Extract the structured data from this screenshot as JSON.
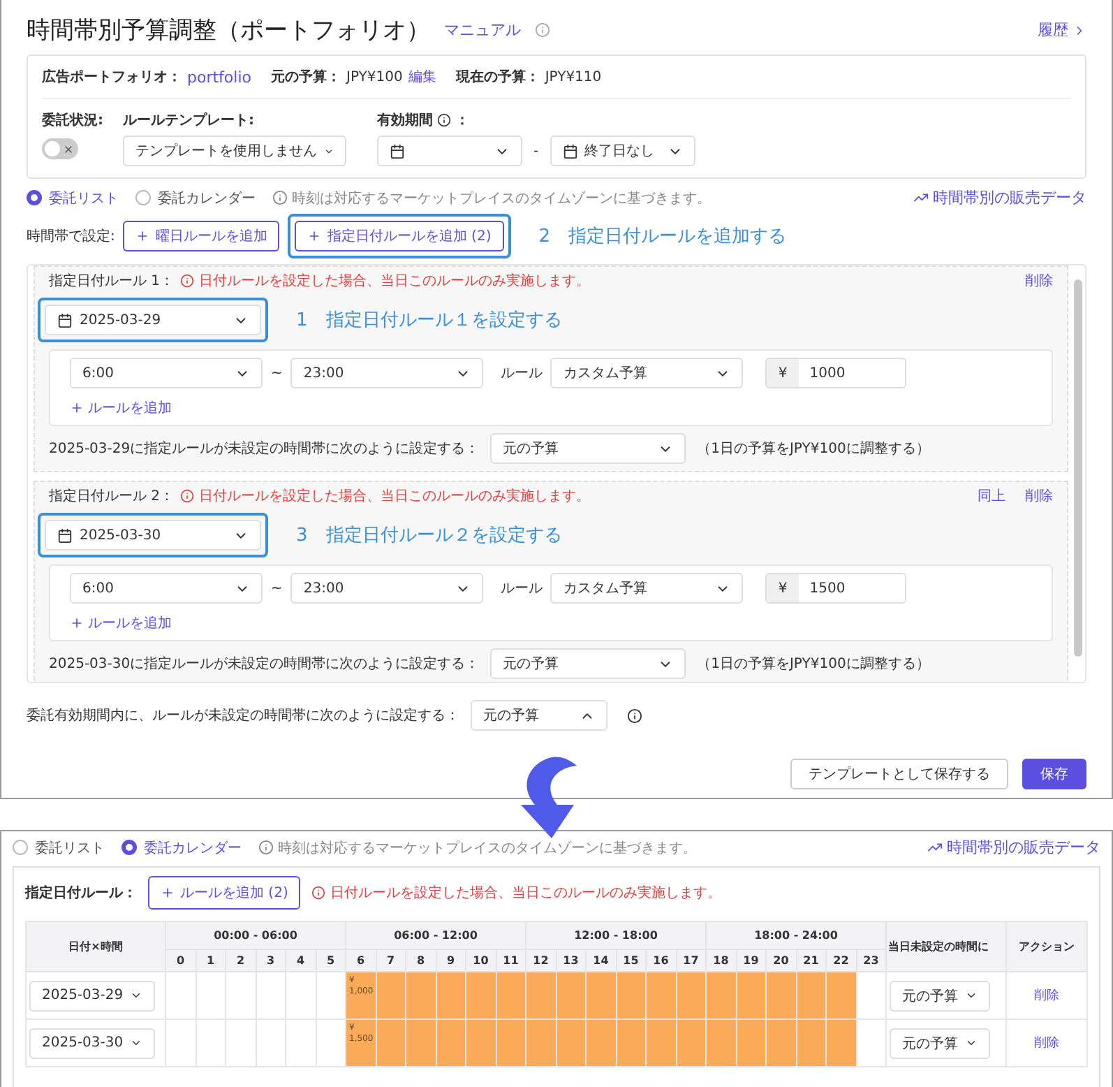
{
  "dialog": {
    "title": "時間帯別予算調整（ポートフォリオ）",
    "manual_link": "マニュアル",
    "history_link": "履歴",
    "info": {
      "items": [
        {
          "label": "広告ポートフォリオ：",
          "value": "portfolio",
          "kind": "link"
        },
        {
          "label": "元の予算：",
          "value": "JPY¥100",
          "edit": "編集",
          "kind": "text"
        },
        {
          "label": "現在の予算：",
          "value": "JPY¥110",
          "kind": "text"
        }
      ],
      "delegation": {
        "label": "委託状況:",
        "on": false
      },
      "template": {
        "label": "ルールテンプレート:",
        "value": "テンプレートを使用しません"
      },
      "period": {
        "label": "有効期間",
        "suffix": "：",
        "separator": "-",
        "end": "終了日なし"
      }
    },
    "views": [
      {
        "label": "委託リスト",
        "selected": true
      },
      {
        "label": "委託カレンダー",
        "selected": false
      }
    ],
    "timezone_note": "時刻は対応するマーケットプレイスのタイムゾーンに基づきます。",
    "sales_link": "時間帯別の販売データ",
    "slot_label": "時間帯で設定:",
    "add_buttons": [
      {
        "label": "曜日ルールを追加",
        "highlighted": false
      },
      {
        "label": "指定日付ルールを追加 (2)",
        "highlighted": true,
        "callout": "2　指定日付ルールを追加する"
      }
    ],
    "date_rules": [
      {
        "label": "指定日付ルール 1：",
        "warning": "日付ルールを設定した場合、当日このルールのみ実施します。",
        "actions": [
          "削除"
        ],
        "date": "2025-03-29",
        "callout": "1　指定日付ルール１を設定する",
        "rows": [
          {
            "start": "6:00",
            "tilde": "~",
            "end": "23:00",
            "rule_label": "ルール",
            "rule": "カスタム予算",
            "currency": "¥",
            "amount": "1000"
          }
        ],
        "add_rule": "ルールを追加",
        "fallback_label": "2025-03-29に指定ルールが未設定の時間帯に次のように設定する：",
        "fallback_value": "元の予算",
        "fallback_note": "（1日の予算をJPY¥100に調整する）"
      },
      {
        "label": "指定日付ルール 2：",
        "warning": "日付ルールを設定した場合、当日このルールのみ実施します。",
        "actions": [
          "同上",
          "削除"
        ],
        "date": "2025-03-30",
        "callout": "3　指定日付ルール２を設定する",
        "rows": [
          {
            "start": "6:00",
            "tilde": "~",
            "end": "23:00",
            "rule_label": "ルール",
            "rule": "カスタム予算",
            "currency": "¥",
            "amount": "1500"
          }
        ],
        "add_rule": "ルールを追加",
        "fallback_label": "2025-03-30に指定ルールが未設定の時間帯に次のように設定する：",
        "fallback_value": "元の予算",
        "fallback_note": "（1日の予算をJPY¥100に調整する）"
      }
    ],
    "default_fallback": {
      "label": "委託有効期間内に、ルールが未設定の時間帯に次のように設定する：",
      "value": "元の予算",
      "expanded": true
    },
    "footer_buttons": [
      {
        "label": "テンプレートとして保存する",
        "kind": "secondary"
      },
      {
        "label": "保存",
        "kind": "primary"
      }
    ]
  },
  "calendar_view": {
    "views": [
      {
        "label": "委託リスト",
        "selected": false
      },
      {
        "label": "委託カレンダー",
        "selected": true
      }
    ],
    "timezone_note": "時刻は対応するマーケットプレイスのタイムゾーンに基づきます。",
    "sales_link": "時間帯別の販売データ",
    "rule_label": "指定日付ルール：",
    "add_button": "ルールを追加 (2)",
    "warning": "日付ルールを設定した場合、当日このルールのみ実施します。",
    "table": {
      "date_header": "日付×時間",
      "groups": [
        "00:00 - 06:00",
        "06:00 - 12:00",
        "12:00 - 18:00",
        "18:00 - 24:00"
      ],
      "hours": [
        "0",
        "1",
        "2",
        "3",
        "4",
        "5",
        "6",
        "7",
        "8",
        "9",
        "10",
        "11",
        "12",
        "13",
        "14",
        "15",
        "16",
        "17",
        "18",
        "19",
        "20",
        "21",
        "22",
        "23"
      ],
      "fallback_header": "当日未設定の時間に",
      "action_header": "アクション",
      "rows": [
        {
          "date": "2025-03-29",
          "fallback": "元の予算",
          "action": "削除",
          "cells": [
            {
              "filled": false
            },
            {
              "filled": false
            },
            {
              "filled": false
            },
            {
              "filled": false
            },
            {
              "filled": false
            },
            {
              "filled": false
            },
            {
              "filled": true,
              "currency": "¥",
              "amount": "1,000"
            },
            {
              "filled": true
            },
            {
              "filled": true
            },
            {
              "filled": true
            },
            {
              "filled": true
            },
            {
              "filled": true
            },
            {
              "filled": true
            },
            {
              "filled": true
            },
            {
              "filled": true
            },
            {
              "filled": true
            },
            {
              "filled": true
            },
            {
              "filled": true
            },
            {
              "filled": true
            },
            {
              "filled": true
            },
            {
              "filled": true
            },
            {
              "filled": true
            },
            {
              "filled": true
            },
            {
              "filled": false
            }
          ]
        },
        {
          "date": "2025-03-30",
          "fallback": "元の予算",
          "action": "削除",
          "cells": [
            {
              "filled": false
            },
            {
              "filled": false
            },
            {
              "filled": false
            },
            {
              "filled": false
            },
            {
              "filled": false
            },
            {
              "filled": false
            },
            {
              "filled": true,
              "currency": "¥",
              "amount": "1,500"
            },
            {
              "filled": true
            },
            {
              "filled": true
            },
            {
              "filled": true
            },
            {
              "filled": true
            },
            {
              "filled": true
            },
            {
              "filled": true
            },
            {
              "filled": true
            },
            {
              "filled": true
            },
            {
              "filled": true
            },
            {
              "filled": true
            },
            {
              "filled": true
            },
            {
              "filled": true
            },
            {
              "filled": true
            },
            {
              "filled": true
            },
            {
              "filled": true
            },
            {
              "filled": true
            },
            {
              "filled": false
            }
          ]
        }
      ]
    }
  }
}
